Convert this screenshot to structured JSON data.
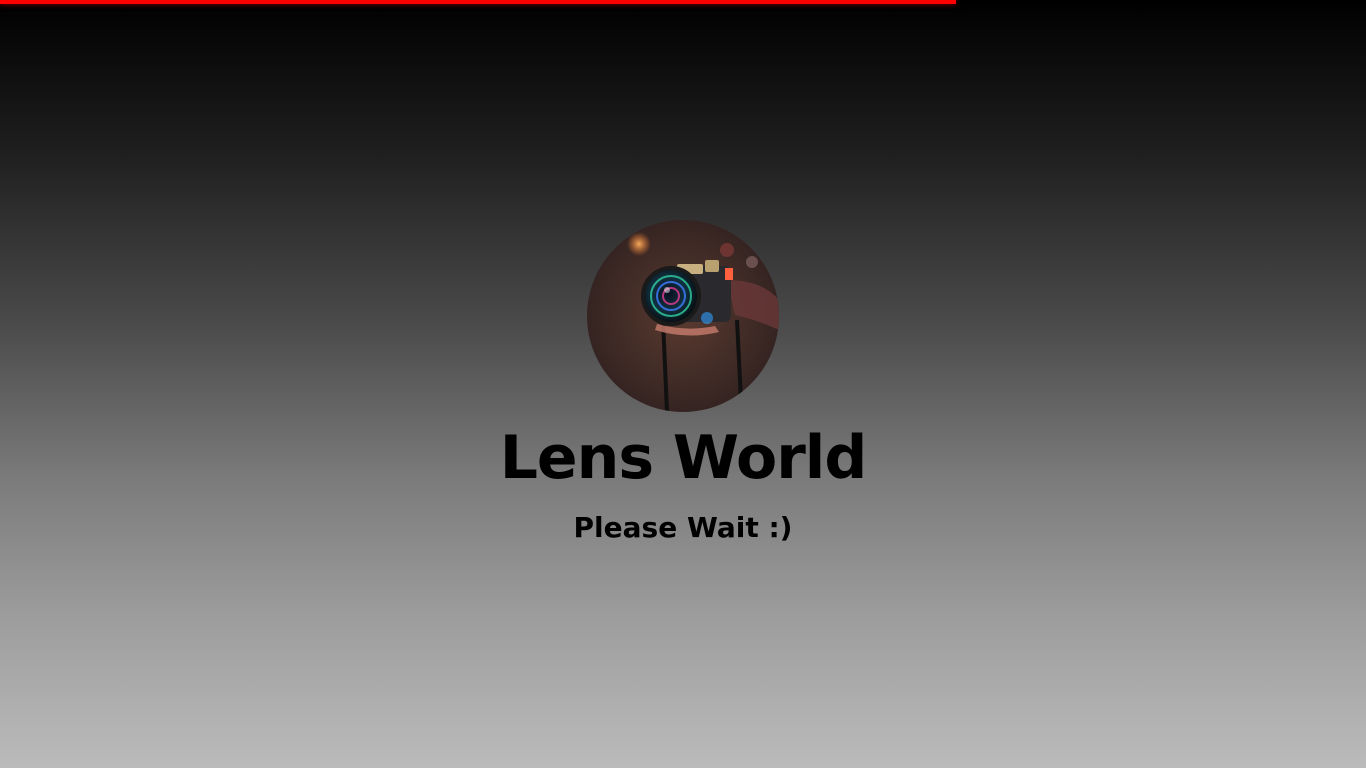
{
  "loader": {
    "progress_percent": 70,
    "bar_color": "#ff0000"
  },
  "brand": {
    "title": "Lens World",
    "logo_icon": "camera-photo-icon"
  },
  "status": {
    "message": "Please Wait :)"
  }
}
